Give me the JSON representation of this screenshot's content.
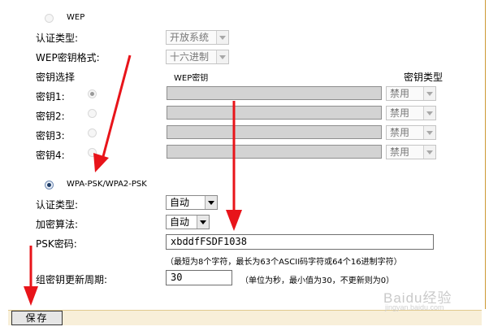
{
  "wep": {
    "title": "WEP",
    "auth_type_label": "认证类型:",
    "auth_type_value": "开放系统",
    "key_format_label": "WEP密钥格式:",
    "key_format_value": "十六进制",
    "key_select_header": "密钥选择",
    "wep_key_header": "WEP密钥",
    "key_type_header": "密钥类型",
    "keys": [
      {
        "label": "密钥1:",
        "type": "禁用"
      },
      {
        "label": "密钥2:",
        "type": "禁用"
      },
      {
        "label": "密钥3:",
        "type": "禁用"
      },
      {
        "label": "密钥4:",
        "type": "禁用"
      }
    ]
  },
  "wpa": {
    "title": "WPA-PSK/WPA2-PSK",
    "auth_type_label": "认证类型:",
    "auth_type_value": "自动",
    "encryption_label": "加密算法:",
    "encryption_value": "自动",
    "psk_label": "PSK密码:",
    "psk_value": "xbddfFSDF1038",
    "psk_hint": "（最短为8个字符，最长为63个ASCII码字符或64个16进制字符）",
    "rekey_label": "组密钥更新周期:",
    "rekey_value": "30",
    "rekey_hint": "（单位为秒，最小值为30，不更新则为0）"
  },
  "save_label": "保存",
  "watermark": {
    "brand": "Baidu经验",
    "url": "jingyan.baidu.com"
  },
  "icons": {
    "arrow": "red-arrow-icon"
  },
  "colors": {
    "arrow": "#e8141a",
    "border": "#cc9933",
    "footer": "#f8efd9"
  }
}
